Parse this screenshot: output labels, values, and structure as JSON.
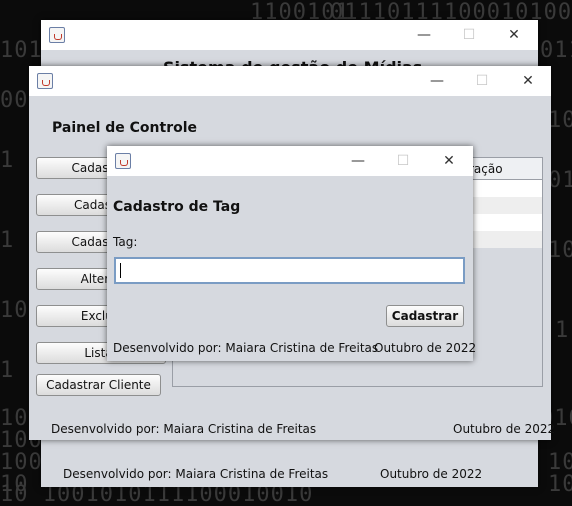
{
  "background": {
    "rows": [
      "1100101",
      "01110111100010100",
      "10101",
      "0111",
      "0010",
      "1001",
      "1",
      "010",
      "1",
      "1011",
      "10",
      "1",
      "1",
      "10 1000",
      "0101",
      "1001",
      "100",
      "10",
      "10",
      "100",
      "10 1001010111100010010"
    ]
  },
  "back_window": {
    "title_partial": "Sistema de gestão de Mídias",
    "footer_dev": "Desenvolvido por: Maiara Cristina de Freitas",
    "footer_date": "Outubro de 2022"
  },
  "middle_window": {
    "heading": "Painel de Controle",
    "buttons": [
      "Cadastrar",
      "Cadastra",
      "Cadastrar",
      "Alterar",
      "Excluir",
      "Listar"
    ],
    "cadastrar_cliente": "Cadastrar Cliente",
    "table_header_partial": "ração",
    "footer_dev": "Desenvolvido por: Maiara Cristina de Freitas",
    "footer_date": "Outubro de 2022"
  },
  "dialog": {
    "heading": "Cadastro de Tag",
    "tag_label": "Tag:",
    "tag_value": "",
    "submit": "Cadastrar",
    "footer_dev": "Desenvolvido por: Maiara Cristina de Freitas",
    "footer_date": "Outubro de 2022"
  },
  "titlebar_controls": {
    "minimize": "—",
    "maximize": "☐",
    "close": "✕"
  },
  "colors": {
    "window_bg": "#d6d9df",
    "titlebar": "#ffffff",
    "focus_border": "#7a9cc4"
  }
}
